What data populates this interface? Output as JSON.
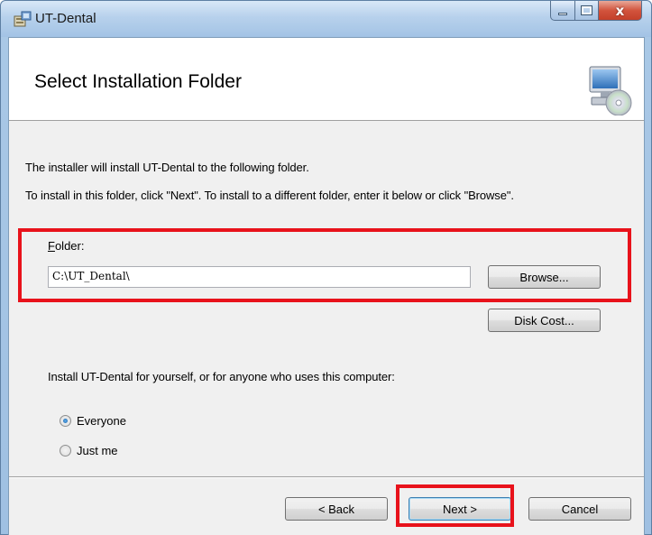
{
  "window": {
    "title": "UT-Dental",
    "close_symbol": "x"
  },
  "header": {
    "title": "Select Installation Folder",
    "icon": "computer-disc-icon"
  },
  "body": {
    "line1": "The installer will install UT-Dental to the following folder.",
    "line2": "To install in this folder, click \"Next\". To install to a different folder, enter it below or click \"Browse\".",
    "folder_label_accel": "F",
    "folder_label_rest": "older:",
    "folder_value": "C:\\UT_Dental\\",
    "browse_label": "Browse...",
    "disk_cost_label": "Disk Cost...",
    "install_for_text": "Install UT-Dental for yourself, or for anyone who uses this computer:",
    "radio_options": [
      {
        "label": "Everyone",
        "checked": true
      },
      {
        "label": "Just me",
        "checked": false
      }
    ]
  },
  "footer": {
    "back_label": "< Back",
    "next_label": "Next >",
    "cancel_label": "Cancel"
  },
  "colors": {
    "highlight": "#e8121b",
    "titlebar": "#b7d1ec"
  }
}
